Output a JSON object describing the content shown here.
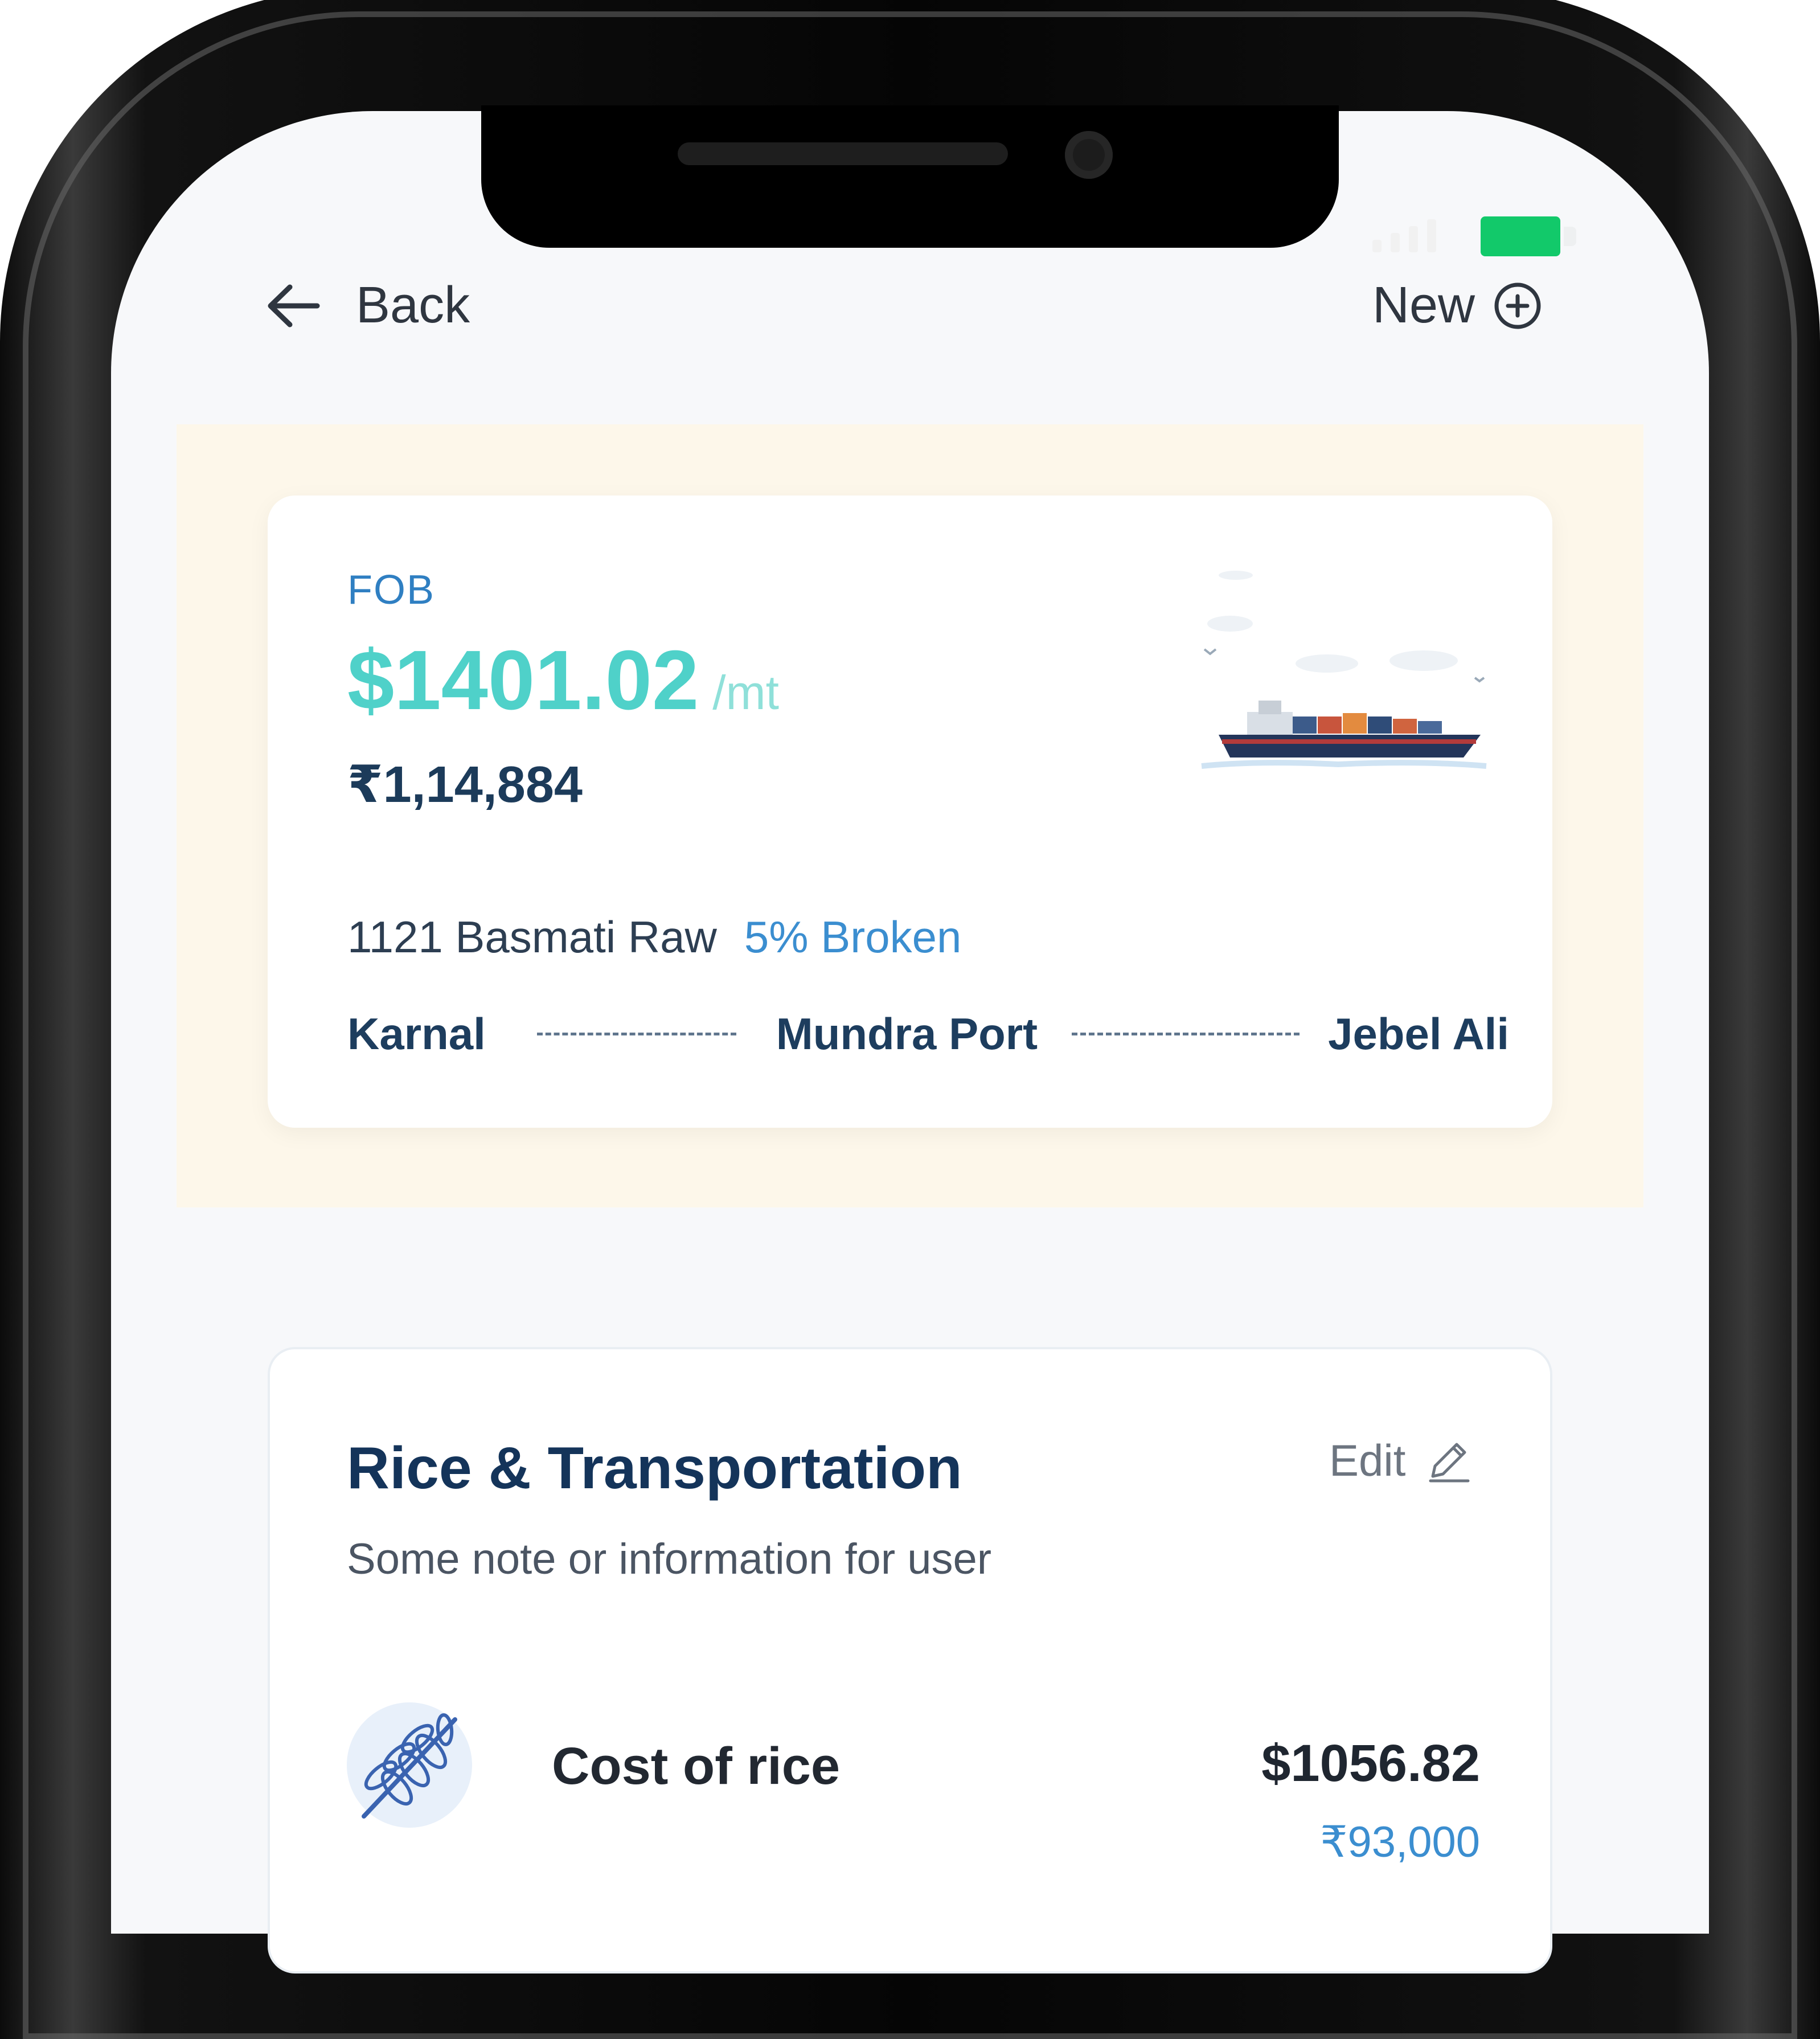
{
  "header": {
    "back_label": "Back",
    "new_label": "New"
  },
  "quote": {
    "term": "FOB",
    "price_usd": "$1401.02",
    "unit": "/mt",
    "price_inr": "₹1,14,884",
    "variety": "1121 Basmati Raw",
    "broken": "5% Broken",
    "route": {
      "origin": "Karnal",
      "port": "Mundra Port",
      "destination": "Jebel Ali"
    }
  },
  "section": {
    "title": "Rice & Transportation",
    "edit_label": "Edit",
    "note": "Some note or information for user",
    "items": [
      {
        "label": "Cost of rice",
        "usd": "$1056.82",
        "inr": "₹93,000",
        "icon": "rice-grain-icon"
      }
    ]
  },
  "colors": {
    "accent_teal": "#4fd1c9",
    "accent_blue": "#3b8ed0",
    "navy": "#14345a",
    "hero_band": "#fdf7ea",
    "battery": "#12c96a"
  }
}
